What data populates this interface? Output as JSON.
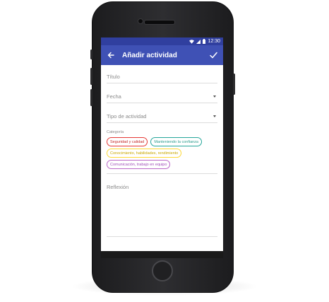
{
  "status_bar": {
    "time": "12:30"
  },
  "app_bar": {
    "title": "Añadir actividad"
  },
  "form": {
    "title_placeholder": "Título",
    "date_placeholder": "Fecha",
    "activity_type_placeholder": "Tipo de actividad",
    "category_label": "Categoría",
    "categories": [
      {
        "label": "Seguridad y calidad",
        "color": "#e53935"
      },
      {
        "label": "Manteniendo la confianza",
        "color": "#26a69a"
      },
      {
        "label": "Conocimiento, habilidades, rendimiento",
        "color": "#fdd835"
      },
      {
        "label": "Comunicación, trabajo en equipo",
        "color": "#ba68c8"
      }
    ],
    "reflection_placeholder": "Reflexión"
  },
  "colors": {
    "primary": "#3f51b5",
    "primary_dark": "#303f9f"
  }
}
